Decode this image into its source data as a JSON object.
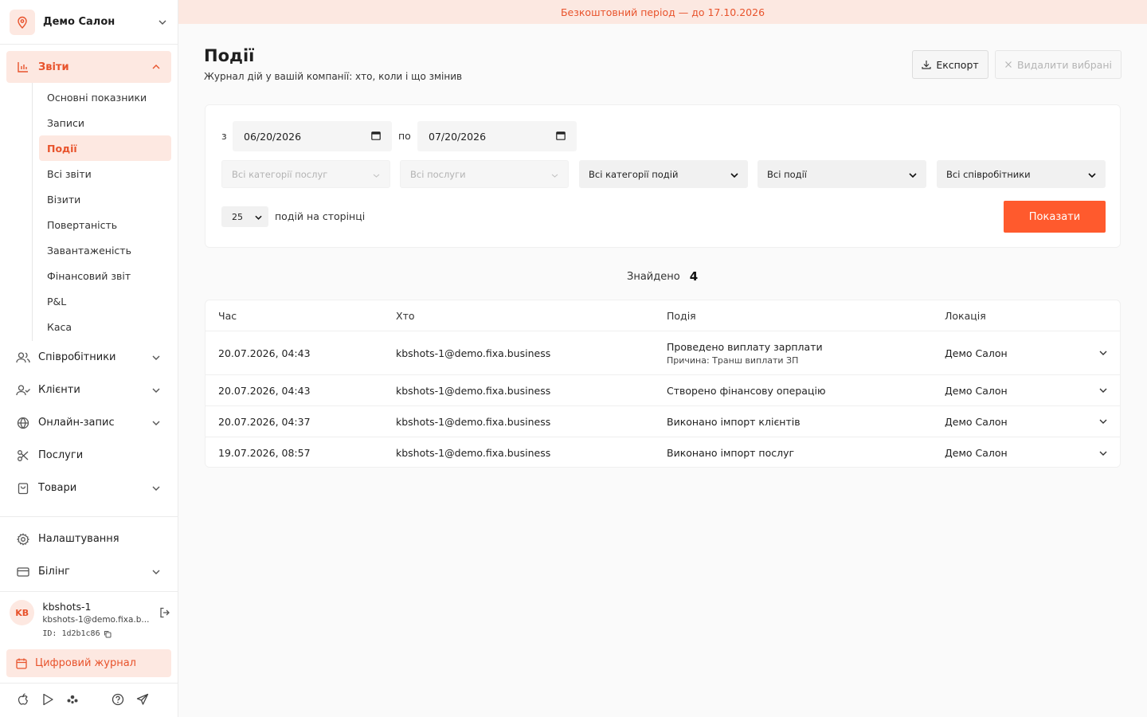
{
  "location": {
    "name": "Демо Салон"
  },
  "nav": {
    "reports": {
      "label": "Звіти"
    },
    "report_items": [
      {
        "label": "Основні показники",
        "active": false
      },
      {
        "label": "Записи",
        "active": false
      },
      {
        "label": "Події",
        "active": true
      },
      {
        "label": "Всі звіти",
        "active": false
      },
      {
        "label": "Візити",
        "active": false
      },
      {
        "label": "Повертаність",
        "active": false
      },
      {
        "label": "Завантаженість",
        "active": false
      },
      {
        "label": "Фінансовий звіт",
        "active": false
      },
      {
        "label": "P&L",
        "active": false
      },
      {
        "label": "Каса",
        "active": false
      }
    ],
    "staff": {
      "label": "Співробітники"
    },
    "clients": {
      "label": "Клієнти"
    },
    "online": {
      "label": "Онлайн-запис"
    },
    "services": {
      "label": "Послуги"
    },
    "goods": {
      "label": "Товари"
    },
    "settings": {
      "label": "Налаштування"
    },
    "billing": {
      "label": "Білінг"
    }
  },
  "user": {
    "initials": "KB",
    "name": "kbshots-1",
    "email": "kbshots-1@demo.fixa.b...",
    "id_label": "ID:",
    "id": "1d2b1c86"
  },
  "journal": {
    "label": "Цифровий журнал"
  },
  "banner": {
    "text": "Безкоштовний період — до 17.10.2026"
  },
  "page": {
    "title": "Події",
    "subtitle": "Журнал дій у вашій компанії: хто, коли і що змінив",
    "export_label": "Експорт",
    "delete_label": "Видалити вибрані"
  },
  "filters": {
    "from_label": "з",
    "from_date": "06/20/2026",
    "to_label": "по",
    "to_date": "07/20/2026",
    "service_categories": "Всі категорії послуг",
    "services": "Всі послуги",
    "event_categories": "Всі категорії подій",
    "events": "Всі події",
    "employees": "Всі співробітники",
    "per_page": "25",
    "per_page_label": "подій на сторінці",
    "show_label": "Показати"
  },
  "results": {
    "found_label": "Знайдено",
    "found_count": "4"
  },
  "table": {
    "headers": {
      "time": "Час",
      "who": "Хто",
      "event": "Подія",
      "location": "Локація"
    },
    "rows": [
      {
        "time": "20.07.2026, 04:43",
        "who": "kbshots-1@demo.fixa.business",
        "event": "Проведено виплату зарплати",
        "reason": "Причина: Транш виплати ЗП",
        "location": "Демо Салон"
      },
      {
        "time": "20.07.2026, 04:43",
        "who": "kbshots-1@demo.fixa.business",
        "event": "Створено фінансову операцію",
        "reason": "",
        "location": "Демо Салон"
      },
      {
        "time": "20.07.2026, 04:37",
        "who": "kbshots-1@demo.fixa.business",
        "event": "Виконано імпорт клієнтів",
        "reason": "",
        "location": "Демо Салон"
      },
      {
        "time": "19.07.2026, 08:57",
        "who": "kbshots-1@demo.fixa.business",
        "event": "Виконано імпорт послуг",
        "reason": "",
        "location": "Демо Салон"
      }
    ]
  },
  "colors": {
    "accent": "#ff5a2d",
    "accent_text": "#e8532c",
    "accent_bg": "#fde8e1"
  }
}
